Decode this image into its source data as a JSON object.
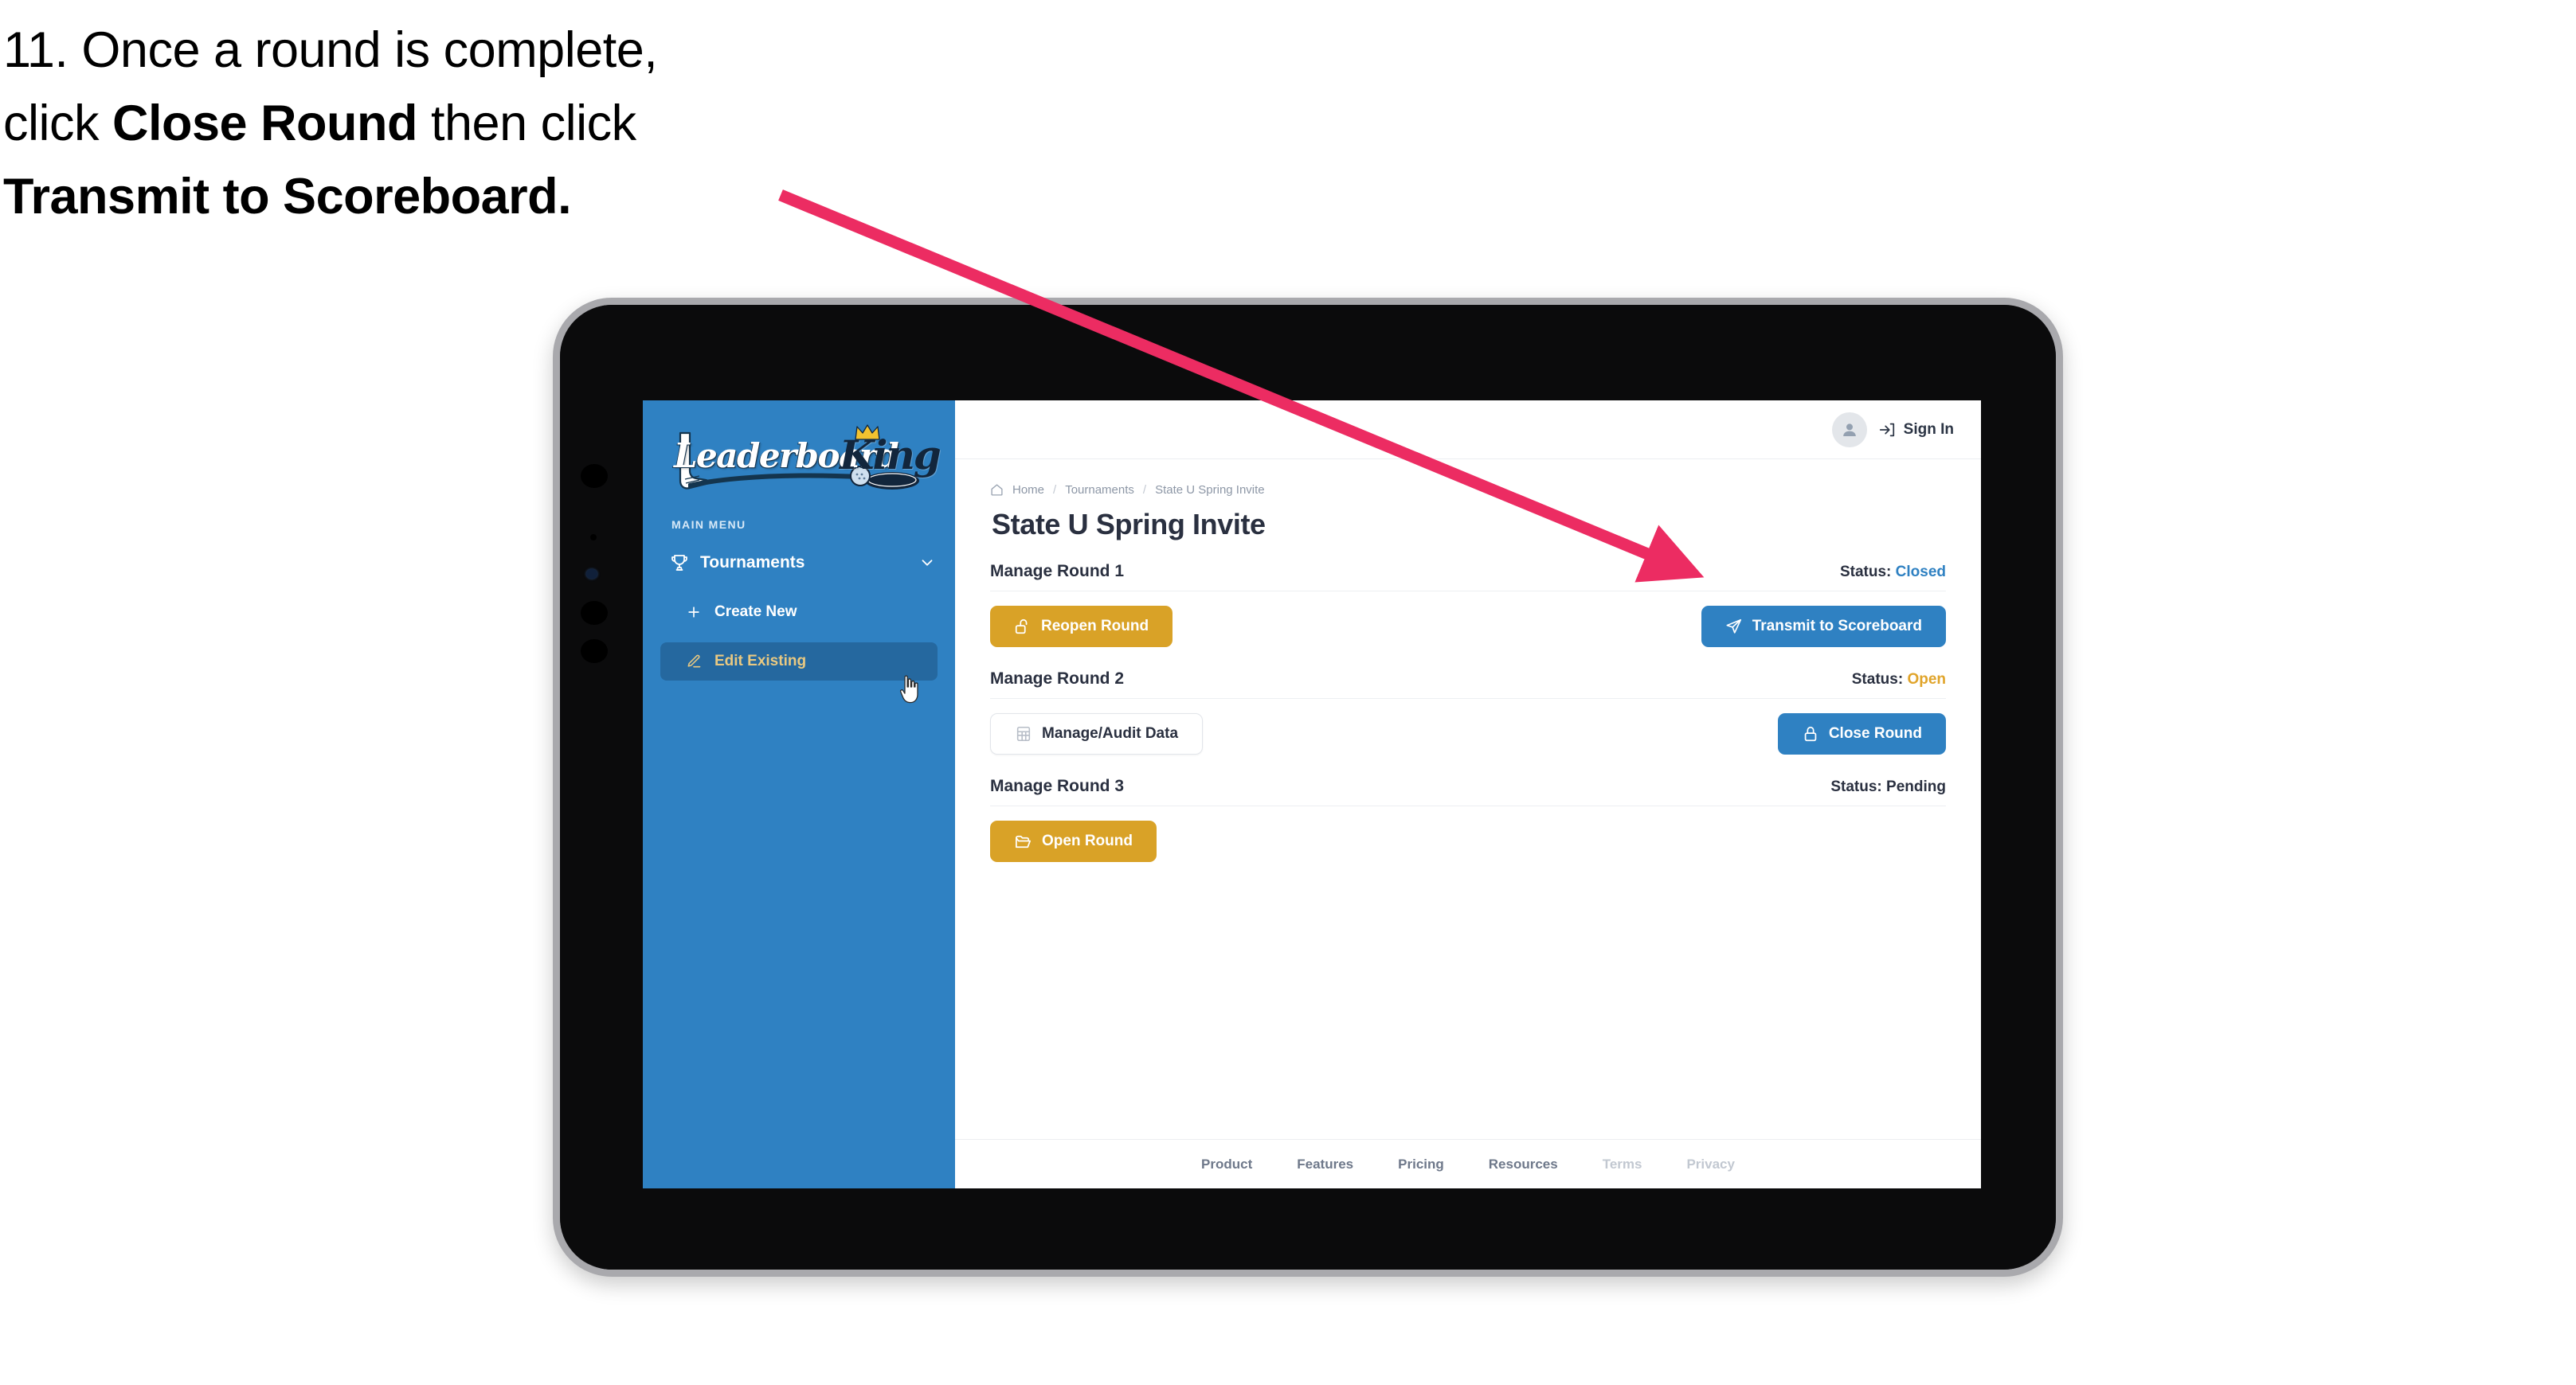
{
  "caption": {
    "line1_prefix": "11. Once a round is complete,",
    "line2_prefix": "click ",
    "line2_bold": "Close Round",
    "line2_suffix": " then click",
    "line3_bold": "Transmit to Scoreboard."
  },
  "colors": {
    "sidebar_blue": "#2f81c2",
    "sidebar_active": "#25689f",
    "active_text_gold": "#e9c982",
    "btn_gold": "#d9a227",
    "btn_blue": "#2f81c2",
    "status_closed": "#2f81c2",
    "status_open": "#e0a42a",
    "arrow_pink": "#ec2c62",
    "text_dark": "#2a3040",
    "muted": "#8d97a6"
  },
  "sidebar": {
    "logo": {
      "word1": "Leaderboard",
      "word2": "King",
      "crown_icon": "crown-icon",
      "club_icon": "golf-club-icon",
      "ball_icon": "golf-ball-icon"
    },
    "section_label": "MAIN MENU",
    "nav": {
      "label": "Tournaments",
      "icon": "trophy-icon",
      "chevron": "chevron-down-icon",
      "children": [
        {
          "label": "Create New",
          "icon": "plus-icon",
          "active": false
        },
        {
          "label": "Edit Existing",
          "icon": "edit-pencil-icon",
          "active": true
        }
      ]
    },
    "cursor": "hand-pointer-cursor"
  },
  "topbar": {
    "avatar_icon": "user-avatar-icon",
    "signin_icon": "sign-in-arrow-icon",
    "signin_label": "Sign In"
  },
  "breadcrumb": {
    "home_icon": "home-icon",
    "items": [
      "Home",
      "Tournaments",
      "State U Spring Invite"
    ],
    "separator": "/"
  },
  "page": {
    "title": "State U Spring Invite"
  },
  "rounds": [
    {
      "name": "Manage Round 1",
      "status_label": "Status:",
      "status_value": "Closed",
      "status_class": "st-closed",
      "left_button": {
        "label": "Reopen Round",
        "icon": "unlock-icon",
        "style": "btn-gold"
      },
      "right_button": {
        "label": "Transmit to Scoreboard",
        "icon": "paper-plane-icon",
        "style": "btn-blue"
      }
    },
    {
      "name": "Manage Round 2",
      "status_label": "Status:",
      "status_value": "Open",
      "status_class": "st-open",
      "left_button": {
        "label": "Manage/Audit Data",
        "icon": "table-grid-icon",
        "style": "btn-white"
      },
      "right_button": {
        "label": "Close Round",
        "icon": "lock-icon",
        "style": "btn-blue"
      }
    },
    {
      "name": "Manage Round 3",
      "status_label": "Status:",
      "status_value": "Pending",
      "status_class": "st-pending",
      "left_button": {
        "label": "Open Round",
        "icon": "open-folder-icon",
        "style": "btn-gold"
      },
      "right_button": null
    }
  ],
  "footer": {
    "links": [
      {
        "label": "Product",
        "dim": false
      },
      {
        "label": "Features",
        "dim": false
      },
      {
        "label": "Pricing",
        "dim": false
      },
      {
        "label": "Resources",
        "dim": false
      },
      {
        "label": "Terms",
        "dim": true
      },
      {
        "label": "Privacy",
        "dim": true
      }
    ]
  }
}
